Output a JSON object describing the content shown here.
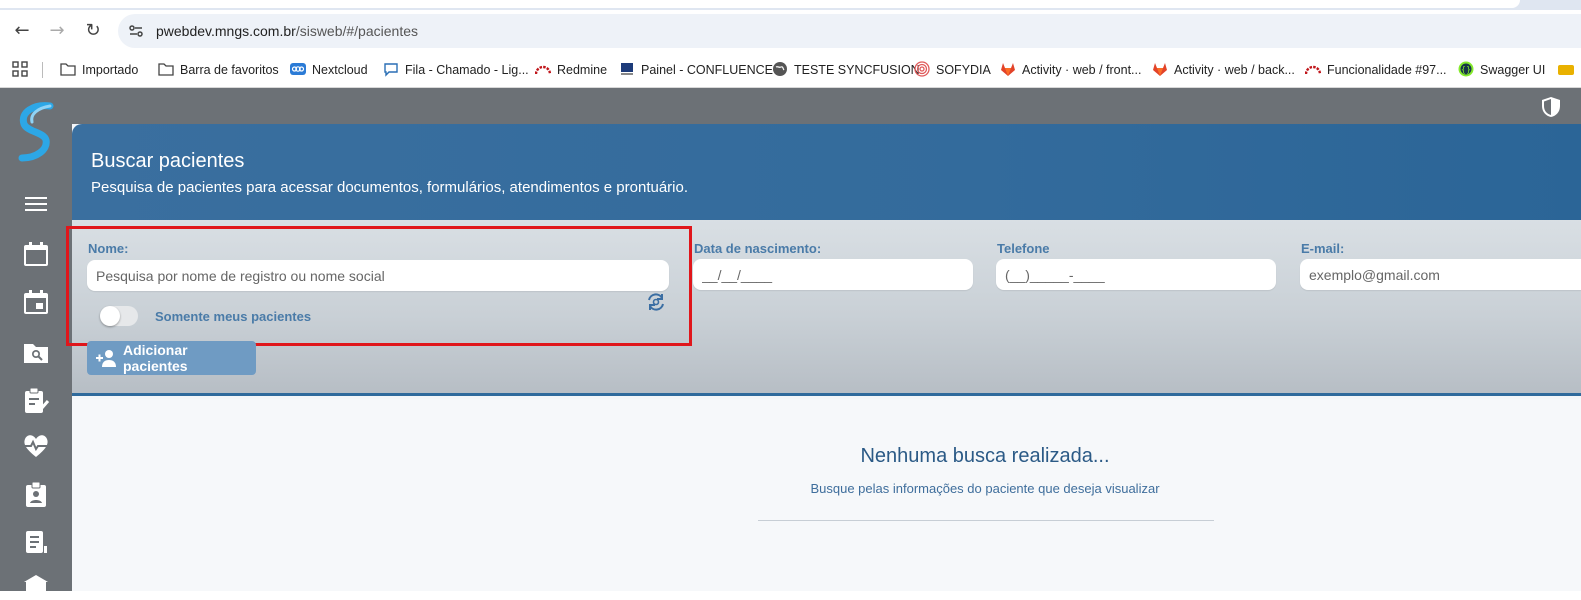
{
  "browser": {
    "url_host": "pwebdev.mngs.com.br",
    "url_path": "/sisweb/#/pacientes",
    "bookmarks": [
      {
        "label": "Importado",
        "icon": "folder-icon"
      },
      {
        "label": "Barra de favoritos",
        "icon": "folder-icon"
      },
      {
        "label": "Nextcloud",
        "icon": "nextcloud-icon"
      },
      {
        "label": "Fila - Chamado - Lig...",
        "icon": "chat-icon"
      },
      {
        "label": "Redmine",
        "icon": "redmine-icon"
      },
      {
        "label": "Painel - CONFLUENCE",
        "icon": "confluence-icon"
      },
      {
        "label": "TESTE SYNCFUSION",
        "icon": "globe-icon"
      },
      {
        "label": "SOFYDIA",
        "icon": "spiral-icon"
      },
      {
        "label": "Activity · web / front...",
        "icon": "gitlab-icon"
      },
      {
        "label": "Activity · web / back...",
        "icon": "gitlab-icon"
      },
      {
        "label": "Funcionalidade #97...",
        "icon": "redmine-icon"
      },
      {
        "label": "Swagger UI",
        "icon": "swagger-icon"
      }
    ]
  },
  "header": {
    "title": "Buscar pacientes",
    "subtitle": "Pesquisa de pacientes para acessar documentos, formulários, atendimentos e prontuário."
  },
  "filters": {
    "nome_label": "Nome:",
    "nome_placeholder": "Pesquisa por nome de registro ou nome social",
    "nascimento_label": "Data de nascimento:",
    "nascimento_placeholder": "__/__/____",
    "telefone_label": "Telefone",
    "telefone_placeholder": "(__)_____-____",
    "email_label": "E-mail:",
    "email_placeholder": "exemplo@gmail.com",
    "toggle_label": "Somente meus pacientes",
    "toggle_on": false,
    "add_button": "Adicionar pacientes"
  },
  "empty_state": {
    "title": "Nenhuma busca realizada...",
    "message": "Busque pelas informações do paciente que deseja visualizar"
  },
  "colors": {
    "header": "#2f6a9c",
    "sidebar": "#6c7176",
    "highlight": "#e0161b",
    "label": "#4a7ba8"
  }
}
